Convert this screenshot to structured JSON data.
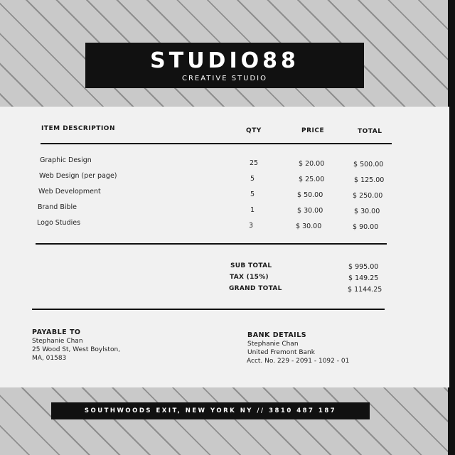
{
  "header": {
    "brand": "STUDIO88",
    "subtitle": "CREATIVE STUDIO"
  },
  "table": {
    "columns": [
      "ITEM DESCRIPTION",
      "QTY",
      "PRICE",
      "TOTAL"
    ],
    "rows": [
      {
        "description": "Graphic Design",
        "qty": "25",
        "price": "$ 20.00",
        "total": "$ 500.00"
      },
      {
        "description": "Web Design (per page)",
        "qty": "5",
        "price": "$ 25.00",
        "total": "$ 125.00"
      },
      {
        "description": "Web Development",
        "qty": "5",
        "price": "$ 50.00",
        "total": "$ 250.00"
      },
      {
        "description": "Brand Bible",
        "qty": "1",
        "price": "$ 30.00",
        "total": "$ 30.00"
      },
      {
        "description": "Logo Studies",
        "qty": "3",
        "price": "$ 30.00",
        "total": "$ 90.00"
      }
    ]
  },
  "summary": {
    "subtotal_label": "SUB TOTAL",
    "subtotal": "$ 995.00",
    "tax_label": "TAX (15%)",
    "tax": "$ 149.25",
    "grand_label": "GRAND TOTAL",
    "grand": "$ 1144.25"
  },
  "payable": {
    "title": "PAYABLE TO",
    "lines": [
      "Stephanie Chan",
      "25 Wood St, West Boylston,",
      "MA, 01583"
    ]
  },
  "bank": {
    "title": "BANK DETAILS",
    "lines": [
      "Stephanie Chan",
      "United Fremont Bank",
      "Acct. No. 229 - 2091 - 1092 - 01"
    ]
  },
  "footer": {
    "text": "SOUTHWOODS EXIT, NEW YORK NY // 3810 487 187"
  },
  "colors": {
    "background": "#c9c9c9",
    "stripe": "#8e8e8e",
    "sheet": "#f1f1f1",
    "dark": "#111111"
  }
}
